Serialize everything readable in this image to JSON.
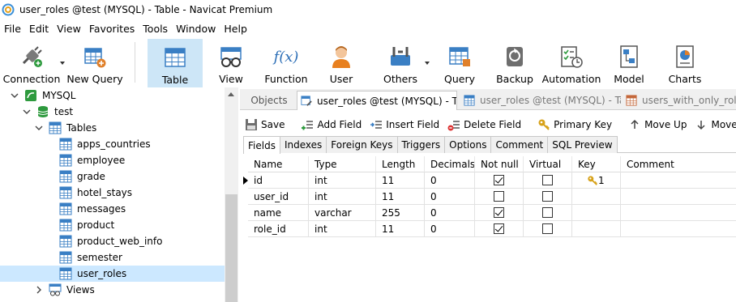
{
  "window": {
    "title": "user_roles @test (MYSQL) - Table - Navicat Premium"
  },
  "menu": [
    "File",
    "Edit",
    "View",
    "Favorites",
    "Tools",
    "Window",
    "Help"
  ],
  "toolbar": {
    "connection": "Connection",
    "new_query": "New Query",
    "table": "Table",
    "view": "View",
    "function": "Function",
    "user": "User",
    "others": "Others",
    "query": "Query",
    "backup": "Backup",
    "automation": "Automation",
    "model": "Model",
    "charts": "Charts",
    "function_glyph": "f(x)"
  },
  "tree": {
    "connection": "MYSQL",
    "database": "test",
    "tables_label": "Tables",
    "tables": [
      "apps_countries",
      "employee",
      "grade",
      "hotel_stays",
      "messages",
      "product",
      "product_web_info",
      "semester",
      "user_roles"
    ],
    "selected": "user_roles",
    "views_label": "Views"
  },
  "tabs": {
    "objects": "Objects",
    "active": "user_roles @test (MYSQL) - Ta...",
    "second": "user_roles @test (MYSQL) - Ta...",
    "third": "users_with_only_role_i"
  },
  "actions": {
    "save": "Save",
    "add_field": "Add Field",
    "insert_field": "Insert Field",
    "delete_field": "Delete Field",
    "primary_key": "Primary Key",
    "move_up": "Move Up",
    "move_down": "Move Down"
  },
  "subtabs": [
    "Fields",
    "Indexes",
    "Foreign Keys",
    "Triggers",
    "Options",
    "Comment",
    "SQL Preview"
  ],
  "grid": {
    "headers": [
      "Name",
      "Type",
      "Length",
      "Decimals",
      "Not null",
      "Virtual",
      "Key",
      "Comment"
    ],
    "rows": [
      {
        "name": "id",
        "type": "int",
        "length": "11",
        "decimals": "0",
        "not_null": true,
        "virtual": false,
        "key": "1",
        "comment": ""
      },
      {
        "name": "user_id",
        "type": "int",
        "length": "11",
        "decimals": "0",
        "not_null": false,
        "virtual": false,
        "key": "",
        "comment": ""
      },
      {
        "name": "name",
        "type": "varchar",
        "length": "255",
        "decimals": "0",
        "not_null": true,
        "virtual": false,
        "key": "",
        "comment": ""
      },
      {
        "name": "role_id",
        "type": "int",
        "length": "11",
        "decimals": "0",
        "not_null": true,
        "virtual": false,
        "key": "",
        "comment": ""
      }
    ]
  },
  "colors": {
    "active_tool_bg": "#cde6f7",
    "selected_row_bg": "#cce8ff",
    "db_green": "#2e9a3e",
    "table_blue": "#3a7fc4",
    "key_gold": "#d7a21a"
  }
}
